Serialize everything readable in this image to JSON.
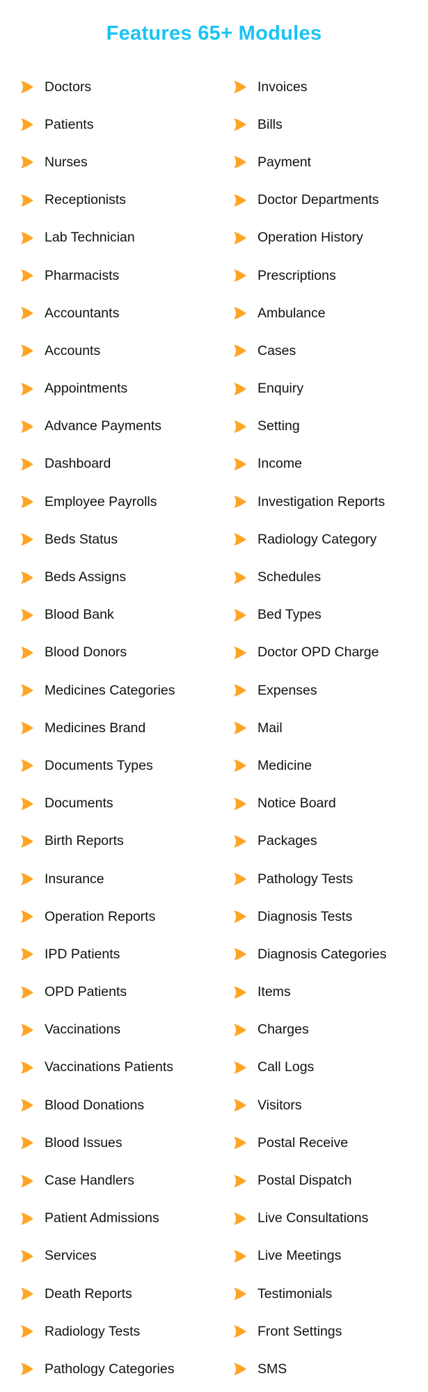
{
  "title": "Features 65+ Modules",
  "colors": {
    "title": "#19c3f5",
    "bullet": "#ffa526",
    "text": "#111111"
  },
  "bullet_icon": "chevron-right-icon",
  "modules": {
    "left": [
      "Doctors",
      "Patients",
      "Nurses",
      "Receptionists",
      "Lab Technician",
      "Pharmacists",
      "Accountants",
      "Accounts",
      "Appointments",
      "Advance Payments",
      "Dashboard",
      "Employee Payrolls",
      "Beds Status",
      "Beds Assigns",
      "Blood Bank",
      "Blood Donors",
      "Medicines Categories",
      "Medicines Brand",
      "Documents Types",
      "Documents",
      "Birth Reports",
      "Insurance",
      "Operation Reports",
      "IPD Patients",
      "OPD Patients",
      "Vaccinations",
      "Vaccinations Patients",
      "Blood Donations",
      "Blood Issues",
      "Case Handlers",
      "Patient Admissions",
      "Services",
      "Death Reports",
      "Radiology Tests",
      "Pathology Categories"
    ],
    "right": [
      "Invoices",
      "Bills",
      "Payment",
      "Doctor Departments",
      "Operation History",
      "Prescriptions",
      "Ambulance",
      "Cases",
      "Enquiry",
      "Setting",
      "Income",
      "Investigation Reports",
      "Radiology Category",
      "Schedules",
      "Bed Types",
      "Doctor OPD Charge",
      "Expenses",
      "Mail",
      "Medicine",
      "Notice Board",
      "Packages",
      "Pathology Tests",
      "Diagnosis Tests",
      "Diagnosis Categories",
      "Items",
      "Charges",
      "Call Logs",
      "Visitors",
      "Postal Receive",
      "Postal Dispatch",
      "Live Consultations",
      "Live Meetings",
      "Testimonials",
      "Front Settings",
      "SMS"
    ]
  }
}
